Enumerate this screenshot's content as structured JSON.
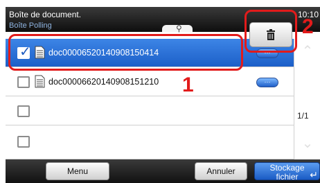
{
  "header": {
    "title": "Boîte de document.",
    "subtitle": "Boîte Polling",
    "time": "10:10"
  },
  "toolbar": {
    "search_icon": "magnifier-icon",
    "delete_icon": "trash-icon"
  },
  "list": {
    "rows": [
      {
        "name": "doc00006520140908150414",
        "checked": true,
        "selected": true,
        "details_label": "···"
      },
      {
        "name": "doc00006620140908151210",
        "checked": false,
        "selected": false,
        "details_label": "···"
      },
      {
        "name": "",
        "checked": false,
        "selected": false
      },
      {
        "name": "",
        "checked": false,
        "selected": false
      }
    ]
  },
  "pagination": {
    "indicator": "1/1"
  },
  "callouts": {
    "one": "1",
    "two": "2"
  },
  "footer": {
    "menu_label": "Menu",
    "cancel_label": "Annuler",
    "store_label_line1": "Stockage",
    "store_label_line2": "fichier"
  },
  "colors": {
    "highlight": "#e21b1b",
    "selected_row": "#2b72dc",
    "accent_button": "#1f5fc9"
  }
}
